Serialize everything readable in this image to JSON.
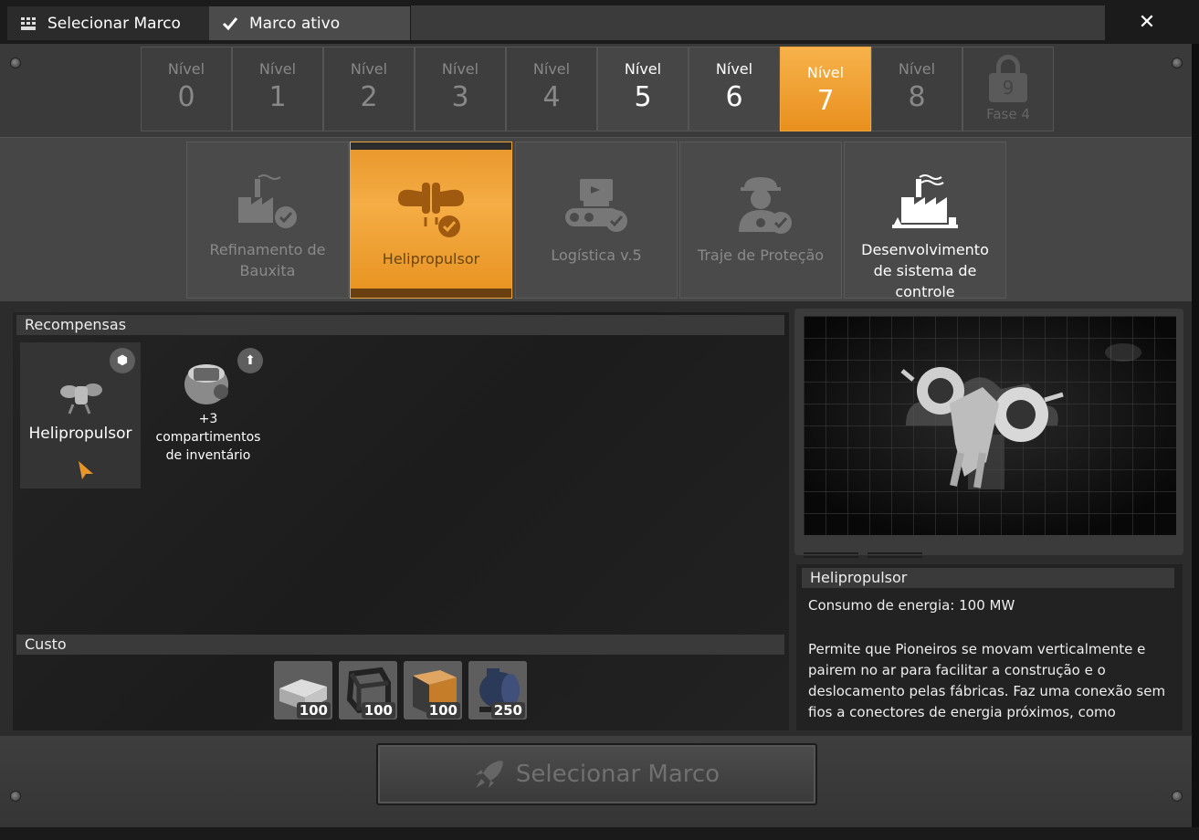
{
  "tabs": [
    {
      "label": "Selecionar Marco",
      "icon": "grid-icon"
    },
    {
      "label": "Marco ativo",
      "icon": "checkmark-icon"
    }
  ],
  "close_label": "✕",
  "levels": [
    {
      "label": "Nível",
      "num": "0",
      "state": "dim"
    },
    {
      "label": "Nível",
      "num": "1",
      "state": "dim"
    },
    {
      "label": "Nível",
      "num": "2",
      "state": "dim"
    },
    {
      "label": "Nível",
      "num": "3",
      "state": "dim"
    },
    {
      "label": "Nível",
      "num": "4",
      "state": "dim"
    },
    {
      "label": "Nível",
      "num": "5",
      "state": "active"
    },
    {
      "label": "Nível",
      "num": "6",
      "state": "active"
    },
    {
      "label": "Nível",
      "num": "7",
      "state": "selected"
    },
    {
      "label": "Nível",
      "num": "8",
      "state": "dim"
    }
  ],
  "locked_level": {
    "num": "9",
    "fase": "Fase 4"
  },
  "milestones": [
    {
      "label": "Refinamento de Bauxita",
      "icon": "factory-check-icon"
    },
    {
      "label": "Helipropulsor",
      "icon": "jetpack-check-icon"
    },
    {
      "label": "Logística v.5",
      "icon": "conveyor-check-icon"
    },
    {
      "label": "Traje de Proteção",
      "icon": "hazmat-check-icon"
    },
    {
      "label": "Desenvolvimento de sistema de controle",
      "icon": "factory-icon"
    }
  ],
  "rewards_header": "Recompensas",
  "rewards": [
    {
      "label": "Helipropulsor",
      "badge_icon": "cube-icon"
    },
    {
      "label_line1": "+3",
      "label_line2": "compartimentos",
      "label_line3": "de inventário",
      "badge_icon": "upgrade-arrow-icon"
    }
  ],
  "cost_header": "Custo",
  "costs": [
    {
      "item": "aluminum-ingot-icon",
      "qty": "100"
    },
    {
      "item": "frame-icon",
      "qty": "100"
    },
    {
      "item": "computer-icon",
      "qty": "100"
    },
    {
      "item": "motor-icon",
      "qty": "250"
    }
  ],
  "description": {
    "title": "Helipropulsor",
    "power": "Consumo de energia: 100 MW",
    "body": "Permite que Pioneiros se movam verticalmente e pairem no ar para facilitar a construção e o deslocamento pelas fábricas. Faz uma conexão sem fios a conectores de energia próximos, como"
  },
  "select_button": "Selecionar Marco",
  "colors": {
    "accent": "#f2a33a",
    "panel": "#3a3a3a"
  }
}
